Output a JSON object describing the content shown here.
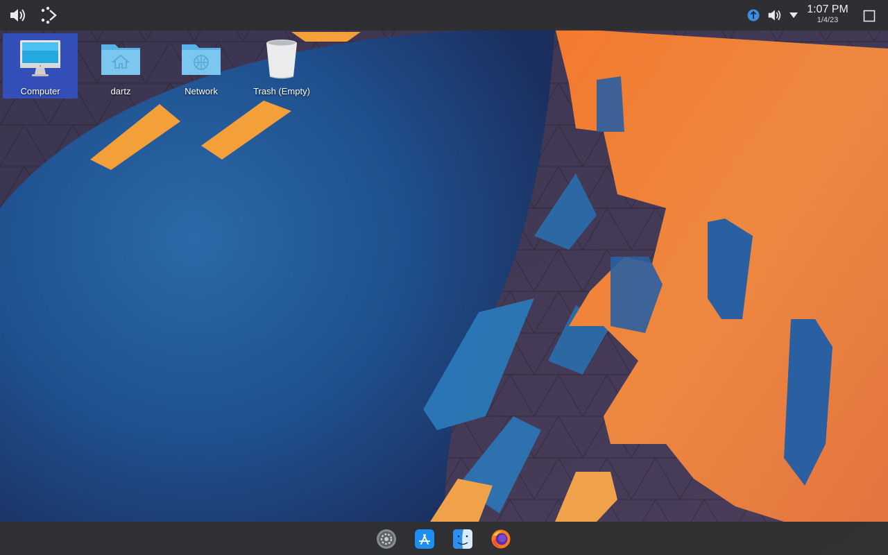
{
  "top_panel": {
    "left_icons": [
      "volume-icon",
      "kde-activities-icon"
    ],
    "tray_icons": [
      "update-notifier-icon",
      "volume-icon",
      "tray-expand-arrow-icon"
    ],
    "clock": {
      "time": "1:07 PM",
      "date": "1/4/23"
    },
    "show_desktop_icon": "show-desktop-icon"
  },
  "desktop": {
    "icons": [
      {
        "label": "Computer",
        "icon": "computer-monitor-icon",
        "selected": true
      },
      {
        "label": "dartz",
        "icon": "home-folder-icon",
        "selected": false
      },
      {
        "label": "Network",
        "icon": "network-folder-icon",
        "selected": false
      },
      {
        "label": "Trash (Empty)",
        "icon": "trash-icon",
        "selected": false
      }
    ],
    "wallpaper": "kde-plasma-abstract-blue-orange"
  },
  "dock": {
    "items": [
      {
        "icon": "system-settings-icon"
      },
      {
        "icon": "app-store-icon"
      },
      {
        "icon": "finder-icon"
      },
      {
        "icon": "firefox-icon"
      }
    ]
  },
  "colors": {
    "panel": "#2d2d30",
    "selection": "#3255d2",
    "wallpaper_blue": "#1f5a9a",
    "wallpaper_orange": "#f08a3c",
    "wallpaper_purple": "#4a3f5e"
  }
}
